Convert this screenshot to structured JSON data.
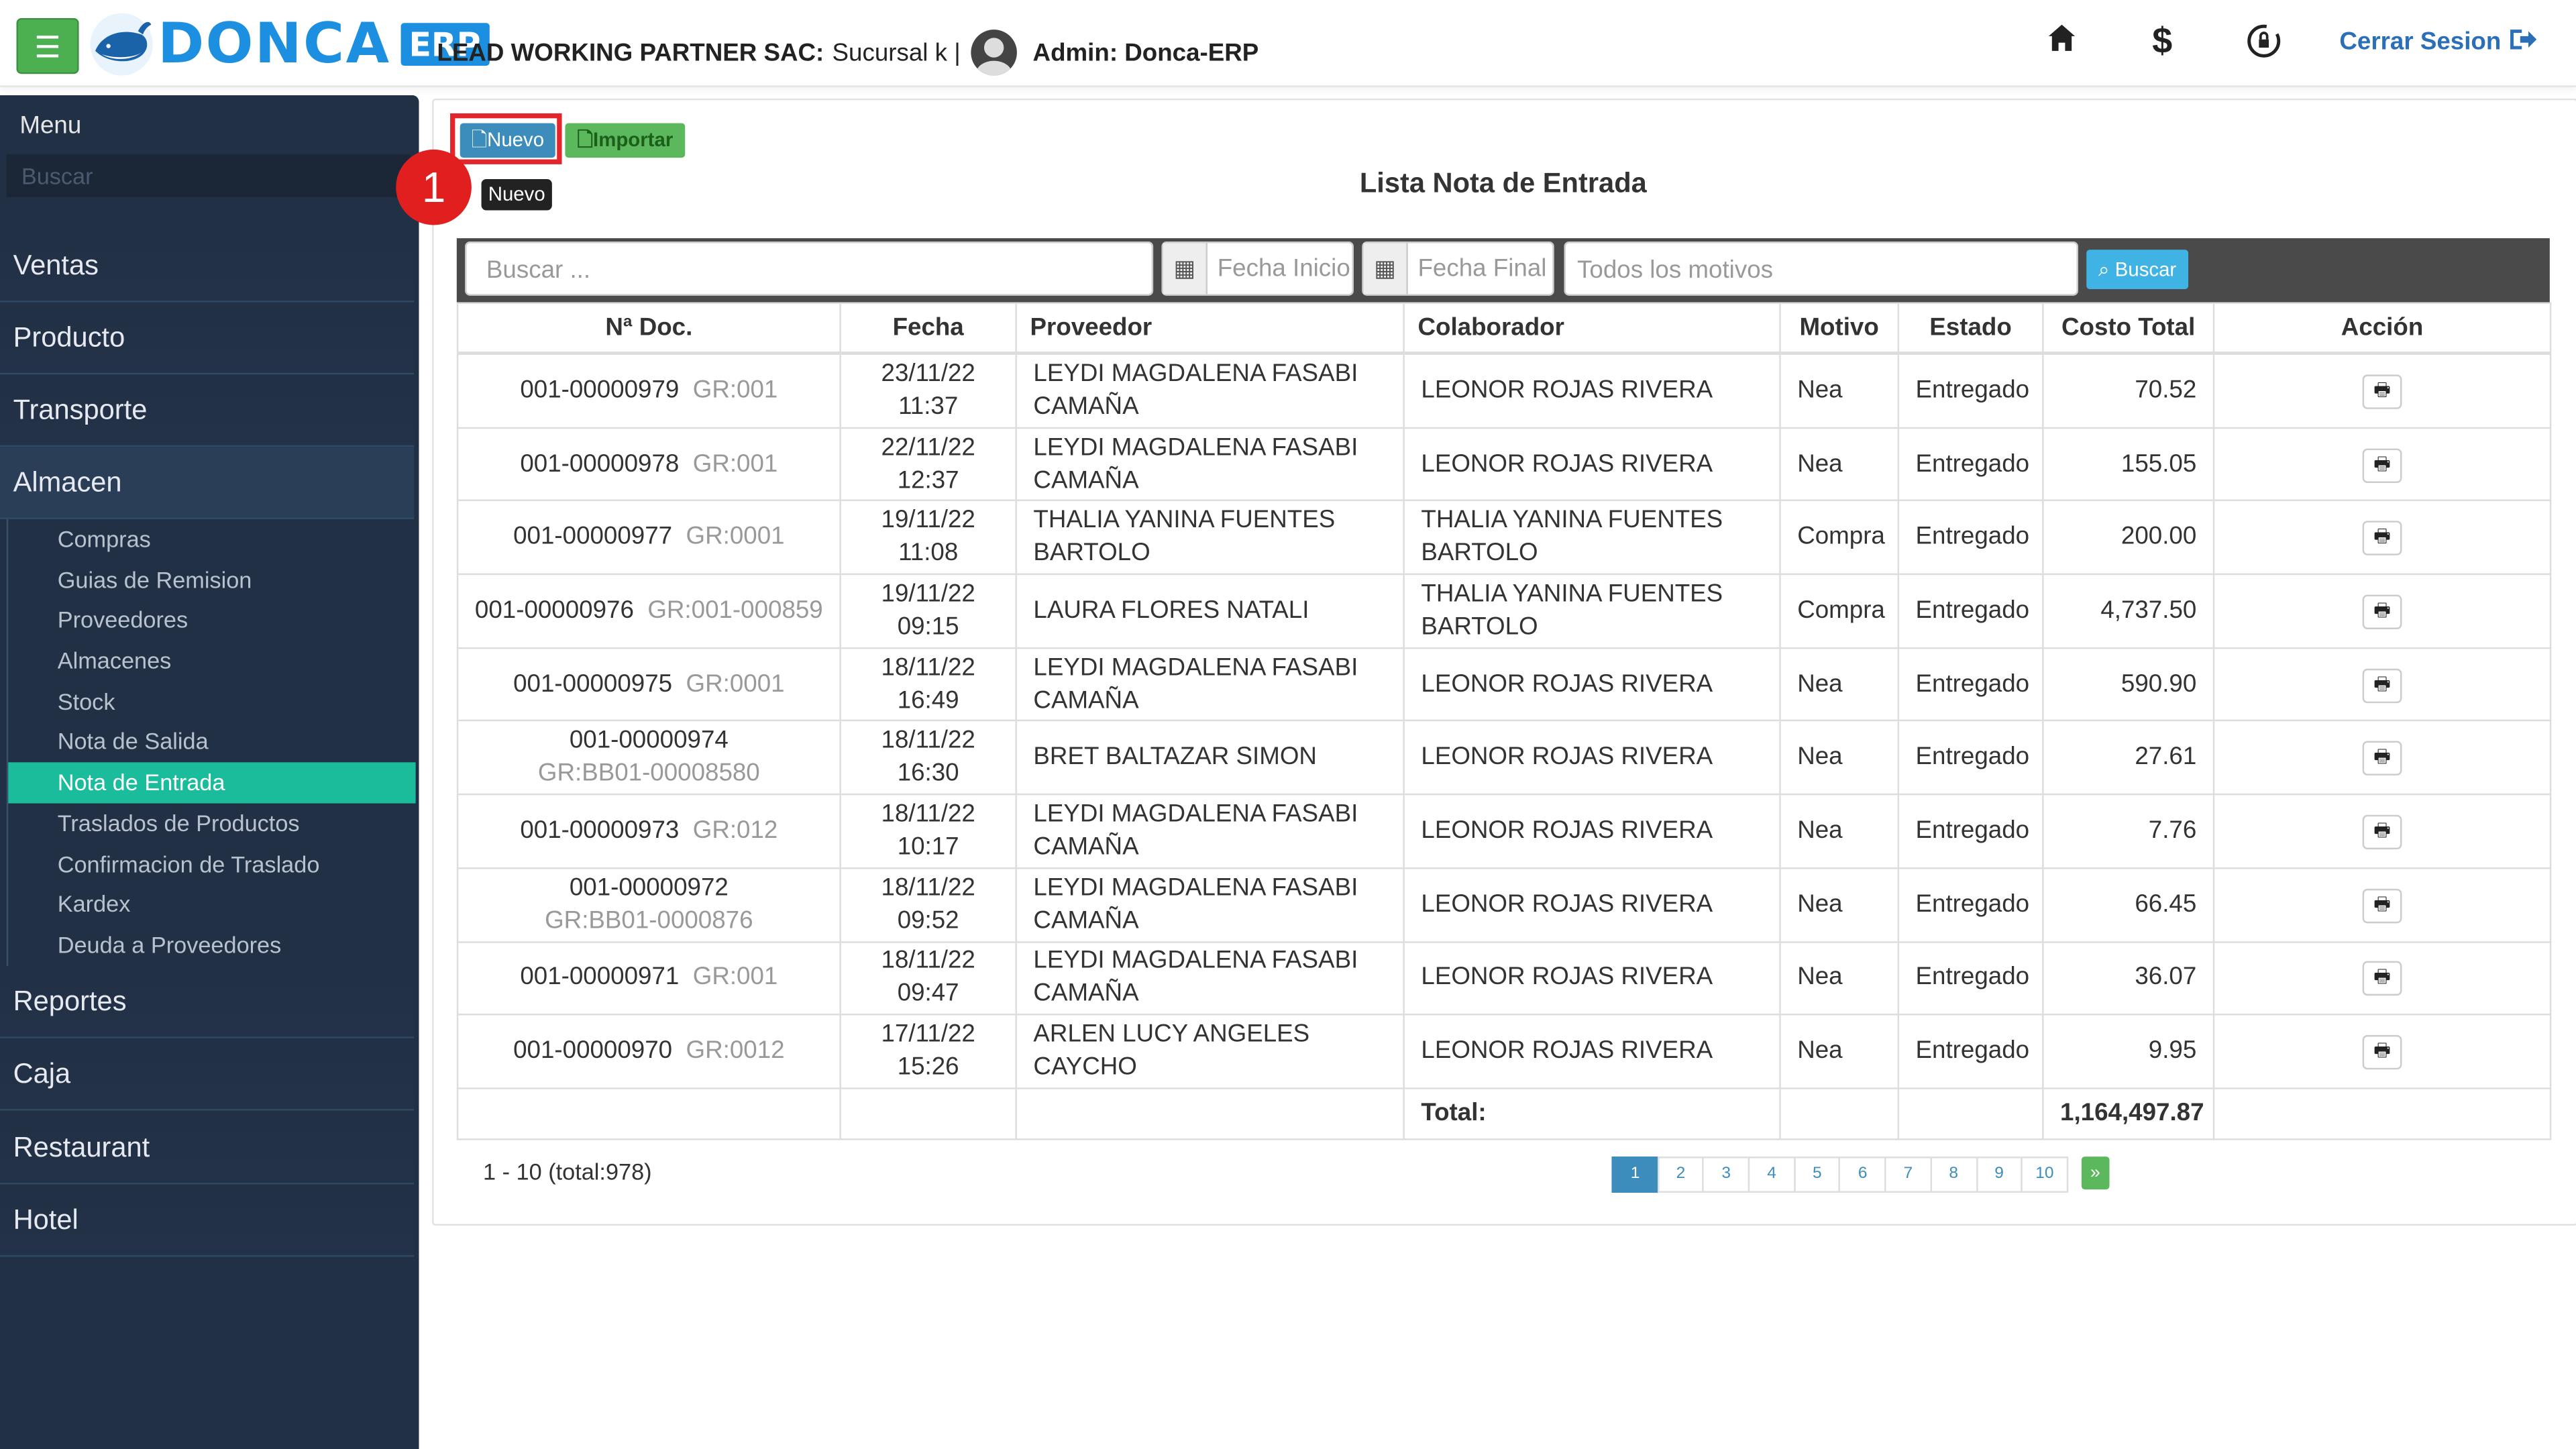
{
  "header": {
    "logo_text": "DONCA",
    "logo_badge": "ERP",
    "company": "LEAD WORKING PARTNER SAC:",
    "branch": "Sucursal k |",
    "admin": "Admin: Donca-ERP",
    "logout_label": "Cerrar Sesion",
    "icons": [
      "home-icon",
      "dollar-icon",
      "lock-rotate-icon",
      "logout-icon"
    ]
  },
  "sidebar": {
    "menu_title": "Menu",
    "search_placeholder": "Buscar",
    "sections": [
      "Ventas",
      "Producto",
      "Transporte",
      "Almacen",
      "Reportes",
      "Caja",
      "Restaurant",
      "Hotel"
    ],
    "almacen_items": [
      "Compras",
      "Guias de Remision",
      "Proveedores",
      "Almacenes",
      "Stock",
      "Nota de Salida",
      "Nota de Entrada",
      "Traslados de Productos",
      "Confirmacion de Traslado",
      "Kardex",
      "Deuda a Proveedores"
    ],
    "active_item": "Nota de Entrada"
  },
  "toolbar": {
    "nuevo_label": "Nuevo",
    "importar_label": "Importar",
    "tooltip": "Nuevo",
    "step_badge": "1"
  },
  "page_title": "Lista Nota de Entrada",
  "filters": {
    "search_placeholder": "Buscar ...",
    "fecha_inicio_placeholder": "Fecha Inicio",
    "fecha_final_placeholder": "Fecha Final",
    "motivo_placeholder": "Todos los motivos",
    "buscar_label": "Buscar"
  },
  "table": {
    "headers": [
      "Nª Doc.",
      "Fecha",
      "Proveedor",
      "Colaborador",
      "Motivo",
      "Estado",
      "Costo Total",
      "Acción"
    ],
    "rows": [
      {
        "doc": "001-00000979",
        "gr": "GR:001",
        "date": "23/11/22",
        "time": "11:37",
        "proveedor": "LEYDI MAGDALENA FASABI CAMAÑA",
        "colaborador": "LEONOR ROJAS RIVERA",
        "motivo": "Nea",
        "estado": "Entregado",
        "costo": "70.52",
        "wrap": false
      },
      {
        "doc": "001-00000978",
        "gr": "GR:001",
        "date": "22/11/22",
        "time": "12:37",
        "proveedor": "LEYDI MAGDALENA FASABI CAMAÑA",
        "colaborador": "LEONOR ROJAS RIVERA",
        "motivo": "Nea",
        "estado": "Entregado",
        "costo": "155.05",
        "wrap": false
      },
      {
        "doc": "001-00000977",
        "gr": "GR:0001",
        "date": "19/11/22",
        "time": "11:08",
        "proveedor": "THALIA YANINA FUENTES BARTOLO",
        "colaborador": "THALIA YANINA FUENTES BARTOLO",
        "motivo": "Compra",
        "estado": "Entregado",
        "costo": "200.00",
        "wrap": false
      },
      {
        "doc": "001-00000976",
        "gr": "GR:001-000859",
        "date": "19/11/22",
        "time": "09:15",
        "proveedor": "LAURA FLORES NATALI",
        "colaborador": "THALIA YANINA FUENTES BARTOLO",
        "motivo": "Compra",
        "estado": "Entregado",
        "costo": "4,737.50",
        "wrap": false
      },
      {
        "doc": "001-00000975",
        "gr": "GR:0001",
        "date": "18/11/22",
        "time": "16:49",
        "proveedor": "LEYDI MAGDALENA FASABI CAMAÑA",
        "colaborador": "LEONOR ROJAS RIVERA",
        "motivo": "Nea",
        "estado": "Entregado",
        "costo": "590.90",
        "wrap": false
      },
      {
        "doc": "001-00000974",
        "gr": "GR:BB01-00008580",
        "date": "18/11/22",
        "time": "16:30",
        "proveedor": "BRET BALTAZAR SIMON",
        "colaborador": "LEONOR ROJAS RIVERA",
        "motivo": "Nea",
        "estado": "Entregado",
        "costo": "27.61",
        "wrap": true
      },
      {
        "doc": "001-00000973",
        "gr": "GR:012",
        "date": "18/11/22",
        "time": "10:17",
        "proveedor": "LEYDI MAGDALENA FASABI CAMAÑA",
        "colaborador": "LEONOR ROJAS RIVERA",
        "motivo": "Nea",
        "estado": "Entregado",
        "costo": "7.76",
        "wrap": false
      },
      {
        "doc": "001-00000972",
        "gr": "GR:BB01-0000876",
        "date": "18/11/22",
        "time": "09:52",
        "proveedor": "LEYDI MAGDALENA FASABI CAMAÑA",
        "colaborador": "LEONOR ROJAS RIVERA",
        "motivo": "Nea",
        "estado": "Entregado",
        "costo": "66.45",
        "wrap": true
      },
      {
        "doc": "001-00000971",
        "gr": "GR:001",
        "date": "18/11/22",
        "time": "09:47",
        "proveedor": "LEYDI MAGDALENA FASABI CAMAÑA",
        "colaborador": "LEONOR ROJAS RIVERA",
        "motivo": "Nea",
        "estado": "Entregado",
        "costo": "36.07",
        "wrap": false
      },
      {
        "doc": "001-00000970",
        "gr": "GR:0012",
        "date": "17/11/22",
        "time": "15:26",
        "proveedor": "ARLEN LUCY ANGELES CAYCHO",
        "colaborador": "LEONOR ROJAS RIVERA",
        "motivo": "Nea",
        "estado": "Entregado",
        "costo": "9.95",
        "wrap": false
      }
    ],
    "total_label": "Total:",
    "total_value": "1,164,497.87"
  },
  "pagination": {
    "summary": "1 - 10 (total:978)",
    "pages": [
      "1",
      "2",
      "3",
      "4",
      "5",
      "6",
      "7",
      "8",
      "9",
      "10"
    ],
    "active": "1",
    "next": "»"
  }
}
